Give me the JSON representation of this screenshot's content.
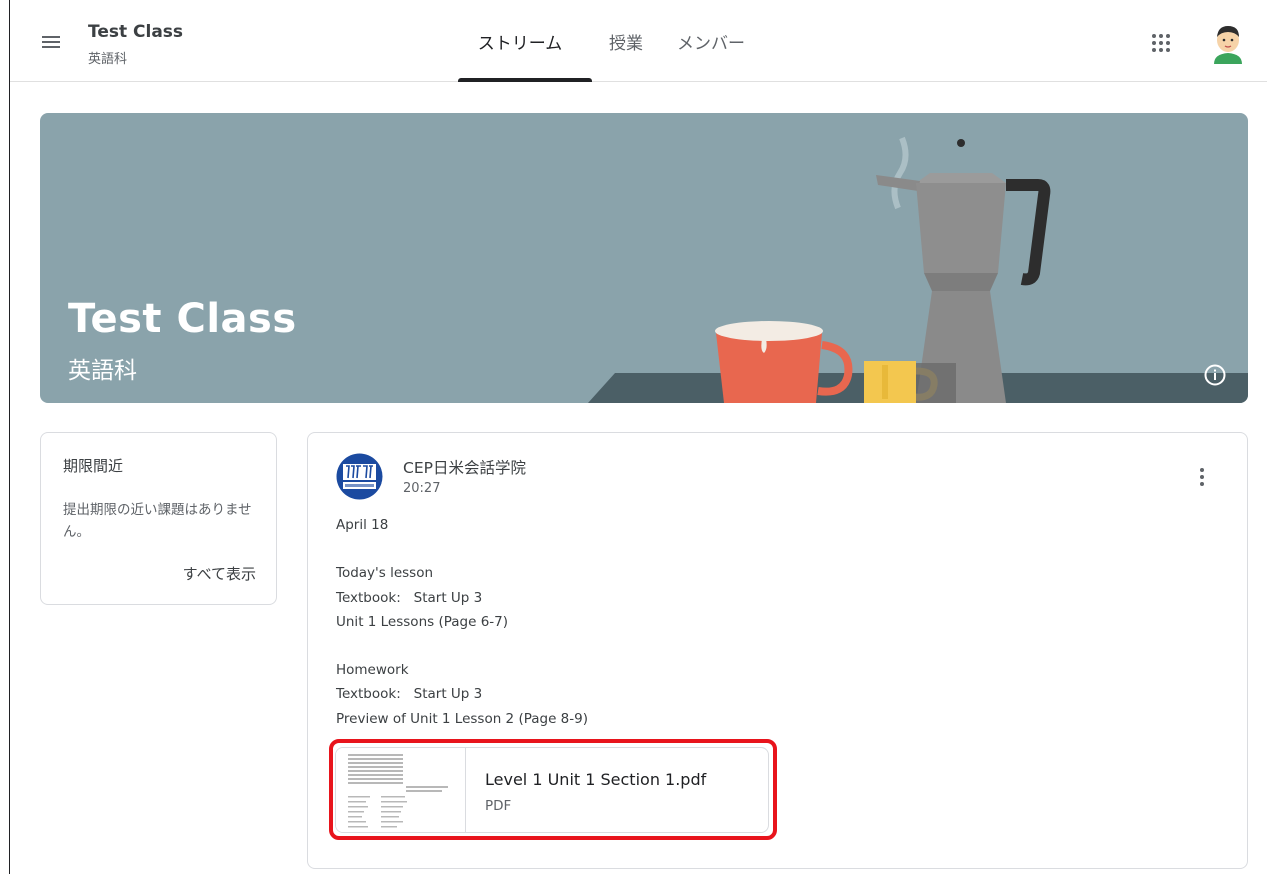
{
  "header": {
    "class_name": "Test Class",
    "section": "英語科",
    "tabs": [
      {
        "label": "ストリーム",
        "active": true
      },
      {
        "label": "授業",
        "active": false
      },
      {
        "label": "メンバー",
        "active": false
      }
    ]
  },
  "banner": {
    "title": "Test Class",
    "subtitle": "英語科",
    "theme_color": "#8aa3ab"
  },
  "upcoming": {
    "title": "期限間近",
    "message": "提出期限の近い課題はありません。",
    "view_all": "すべて表示"
  },
  "post": {
    "author": "CEP日米会話学院",
    "time": "20:27",
    "body_lines": [
      "April 18",
      "",
      "Today's lesson",
      "Textbook:   Start Up 3",
      "Unit 1 Lessons (Page 6-7)",
      "",
      "Homework",
      "Textbook:   Start Up 3",
      "Preview of Unit 1 Lesson 2 (Page 8-9)"
    ],
    "attachment": {
      "name": "Level 1 Unit 1 Section 1.pdf",
      "type": "PDF"
    }
  },
  "icons": {
    "menu": "hamburger-menu-icon",
    "apps": "apps-grid-icon",
    "info": "info-icon",
    "more": "more-vert-icon"
  },
  "colors": {
    "highlight": "#e8141c",
    "active_tab": "#202124"
  }
}
